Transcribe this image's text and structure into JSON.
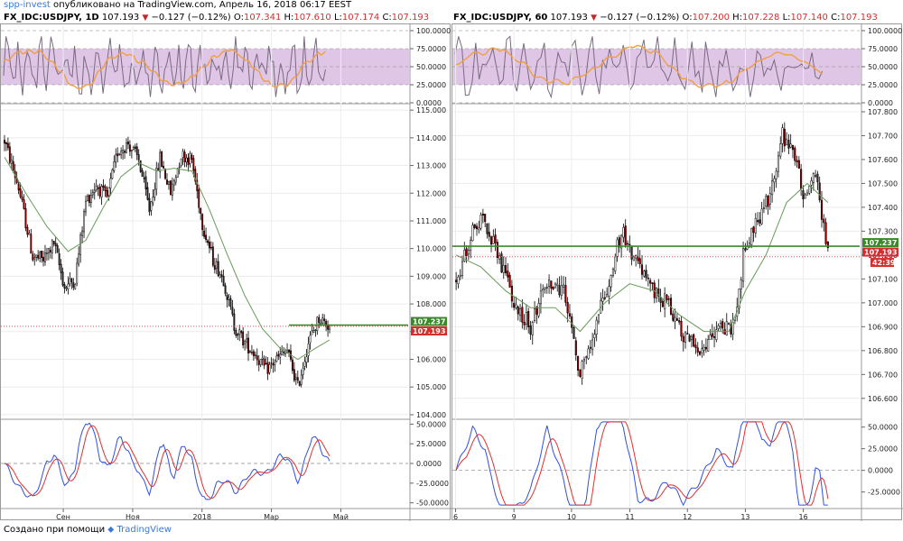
{
  "header": {
    "author": "spp-invest",
    "published_text": " опубликовано на TradingView.com, Апрель 16, 2018 06:17 EEST"
  },
  "footer": {
    "text": "Создано при помощи",
    "brand": "TradingView"
  },
  "colors": {
    "bull": "#ffffff",
    "bear": "#8b0000",
    "wick": "#000000",
    "ma": "#6a9a5a",
    "hline": "#3a8a2a",
    "dotline": "#e05050",
    "rsi_band": "#dcc0e4",
    "rsi_line": "#7a6a80",
    "rsi_ma": "#f0a040",
    "macd": "#3050e0",
    "signal": "#e03030",
    "price_tag_green": "#3a8a2a",
    "price_tag_red": "#d32f2f"
  },
  "chart_data": [
    {
      "type": "candlestick",
      "title": {
        "symbol": "FX_IDC:USDJPY, 1D",
        "last": "107.193",
        "change": "−0.127 (−0.12%)",
        "o_label": "O:",
        "o": "107.341",
        "h_label": "H:",
        "h": "107.610",
        "l_label": "L:",
        "l": "107.174",
        "c_label": "C:",
        "c": "107.193"
      },
      "price_axis": {
        "ticks": [
          "115.000",
          "114.000",
          "113.000",
          "112.000",
          "111.000",
          "110.000",
          "109.000",
          "108.000",
          "107.000",
          "106.000",
          "105.000",
          "104.000"
        ],
        "ylim": [
          103.9,
          115.2
        ]
      },
      "rsi_axis": {
        "ticks": [
          "100.0000",
          "75.0000",
          "50.0000",
          "25.0000",
          "0.0000"
        ],
        "band": [
          25,
          75
        ]
      },
      "macd_axis": {
        "ticks": [
          "50.0000",
          "25.0000",
          "0.0000",
          "-25.0000",
          "-50.0000"
        ],
        "ylim": [
          -55,
          55
        ]
      },
      "x_labels": [
        {
          "label": "Сен",
          "pos": 0.155
        },
        {
          "label": "Ноя",
          "pos": 0.325
        },
        {
          "label": "2018",
          "pos": 0.495
        },
        {
          "label": "Мар",
          "pos": 0.665
        },
        {
          "label": "Май",
          "pos": 0.835
        }
      ],
      "horizontal_level": 107.237,
      "level_label": "107.237",
      "last_price": 107.193,
      "last_label": "107.193",
      "series_path": [
        [
          0,
          113.9
        ],
        [
          8,
          112.2
        ],
        [
          16,
          109.7
        ],
        [
          22,
          109.6
        ],
        [
          28,
          110.2
        ],
        [
          34,
          108.6
        ],
        [
          40,
          108.9
        ],
        [
          46,
          111.7
        ],
        [
          52,
          112.3
        ],
        [
          58,
          111.8
        ],
        [
          64,
          113.5
        ],
        [
          70,
          113.8
        ],
        [
          76,
          113.2
        ],
        [
          82,
          111.4
        ],
        [
          88,
          113.3
        ],
        [
          94,
          112.0
        ],
        [
          100,
          113.4
        ],
        [
          106,
          113.2
        ],
        [
          112,
          110.9
        ],
        [
          118,
          109.6
        ],
        [
          124,
          108.9
        ],
        [
          130,
          107.2
        ],
        [
          136,
          106.6
        ],
        [
          142,
          106.2
        ],
        [
          148,
          105.6
        ],
        [
          154,
          106.0
        ],
        [
          160,
          106.3
        ],
        [
          166,
          105.0
        ],
        [
          172,
          106.6
        ],
        [
          178,
          107.5
        ],
        [
          184,
          107.2
        ]
      ],
      "ma_points": [
        [
          0,
          113.3
        ],
        [
          12,
          112.0
        ],
        [
          24,
          110.8
        ],
        [
          36,
          109.9
        ],
        [
          46,
          110.3
        ],
        [
          56,
          111.5
        ],
        [
          66,
          112.6
        ],
        [
          76,
          113.1
        ],
        [
          86,
          112.8
        ],
        [
          96,
          112.9
        ],
        [
          106,
          112.8
        ],
        [
          116,
          111.4
        ],
        [
          126,
          109.8
        ],
        [
          136,
          108.3
        ],
        [
          146,
          107.1
        ],
        [
          156,
          106.4
        ],
        [
          166,
          106.0
        ],
        [
          176,
          106.4
        ],
        [
          184,
          106.7
        ]
      ],
      "n_bars": 185
    },
    {
      "type": "candlestick",
      "title": {
        "symbol": "FX_IDC:USDJPY, 60",
        "last": "107.193",
        "change": "−0.127 (−0.12%)",
        "o_label": "O:",
        "o": "107.200",
        "h_label": "H:",
        "h": "107.228",
        "l_label": "L:",
        "l": "107.140",
        "c_label": "C:",
        "c": "107.193"
      },
      "price_axis": {
        "ticks": [
          "107.800",
          "107.700",
          "107.600",
          "107.500",
          "107.400",
          "107.300",
          "107.200",
          "107.100",
          "107.000",
          "106.900",
          "106.800",
          "106.700",
          "106.600"
        ],
        "ylim": [
          106.52,
          107.83
        ]
      },
      "rsi_axis": {
        "ticks": [
          "100.0000",
          "75.0000",
          "50.0000",
          "25.0000",
          "0.0000"
        ],
        "band": [
          25,
          75
        ]
      },
      "macd_axis": {
        "ticks": [
          "50.0000",
          "25.0000",
          "0.0000",
          "-25.0000"
        ],
        "ylim": [
          -42,
          58
        ]
      },
      "x_labels": [
        {
          "label": "6",
          "pos": 0.01
        },
        {
          "label": "9",
          "pos": 0.153
        },
        {
          "label": "10",
          "pos": 0.294
        },
        {
          "label": "11",
          "pos": 0.437
        },
        {
          "label": "12",
          "pos": 0.578
        },
        {
          "label": "13",
          "pos": 0.72
        },
        {
          "label": "16",
          "pos": 0.862
        }
      ],
      "horizontal_level": 107.237,
      "level_label": "107.237",
      "last_price": 107.193,
      "last_label": "107.193",
      "countdown": "42:39",
      "series_path": [
        [
          0,
          107.1
        ],
        [
          8,
          107.3
        ],
        [
          14,
          107.35
        ],
        [
          20,
          107.2
        ],
        [
          28,
          107.0
        ],
        [
          36,
          106.9
        ],
        [
          44,
          107.1
        ],
        [
          52,
          107.05
        ],
        [
          60,
          106.7
        ],
        [
          66,
          106.85
        ],
        [
          74,
          107.1
        ],
        [
          80,
          107.3
        ],
        [
          86,
          107.2
        ],
        [
          94,
          107.05
        ],
        [
          102,
          107.0
        ],
        [
          110,
          106.85
        ],
        [
          118,
          106.8
        ],
        [
          126,
          106.9
        ],
        [
          134,
          106.9
        ],
        [
          140,
          107.25
        ],
        [
          146,
          107.35
        ],
        [
          152,
          107.45
        ],
        [
          158,
          107.7
        ],
        [
          163,
          107.65
        ],
        [
          168,
          107.45
        ],
        [
          174,
          107.55
        ],
        [
          180,
          107.2
        ]
      ],
      "ma_points": [
        [
          0,
          107.2
        ],
        [
          12,
          107.15
        ],
        [
          24,
          107.05
        ],
        [
          36,
          106.98
        ],
        [
          48,
          106.98
        ],
        [
          60,
          106.88
        ],
        [
          72,
          107.0
        ],
        [
          84,
          107.08
        ],
        [
          96,
          107.05
        ],
        [
          108,
          106.95
        ],
        [
          120,
          106.88
        ],
        [
          132,
          106.88
        ],
        [
          140,
          107.05
        ],
        [
          150,
          107.2
        ],
        [
          160,
          107.42
        ],
        [
          170,
          107.5
        ],
        [
          180,
          107.42
        ]
      ],
      "n_bars": 181
    }
  ]
}
